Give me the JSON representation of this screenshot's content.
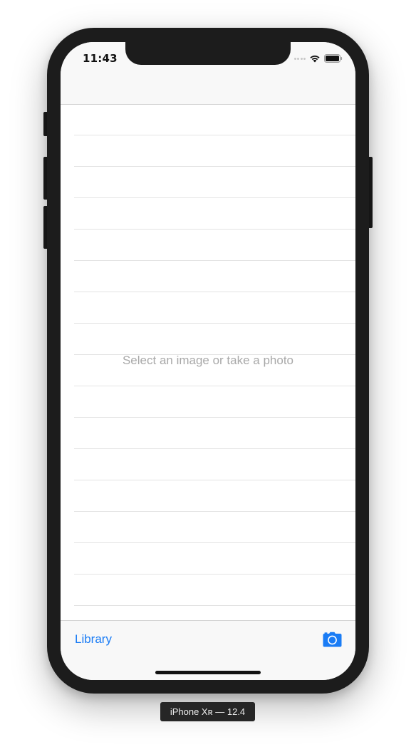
{
  "status_bar": {
    "time": "11:43"
  },
  "content": {
    "empty_message": "Select an image or take a photo",
    "row_count": 16
  },
  "toolbar": {
    "library_label": "Library",
    "camera_icon": "camera-icon"
  },
  "device_label": "iPhone Xʀ — 12.4",
  "colors": {
    "accent": "#1a7cf5",
    "placeholder_text": "#a8a8a8",
    "bar_background": "#f8f8f8",
    "separator": "#e3e3e3",
    "device_frame": "#1c1c1c"
  }
}
